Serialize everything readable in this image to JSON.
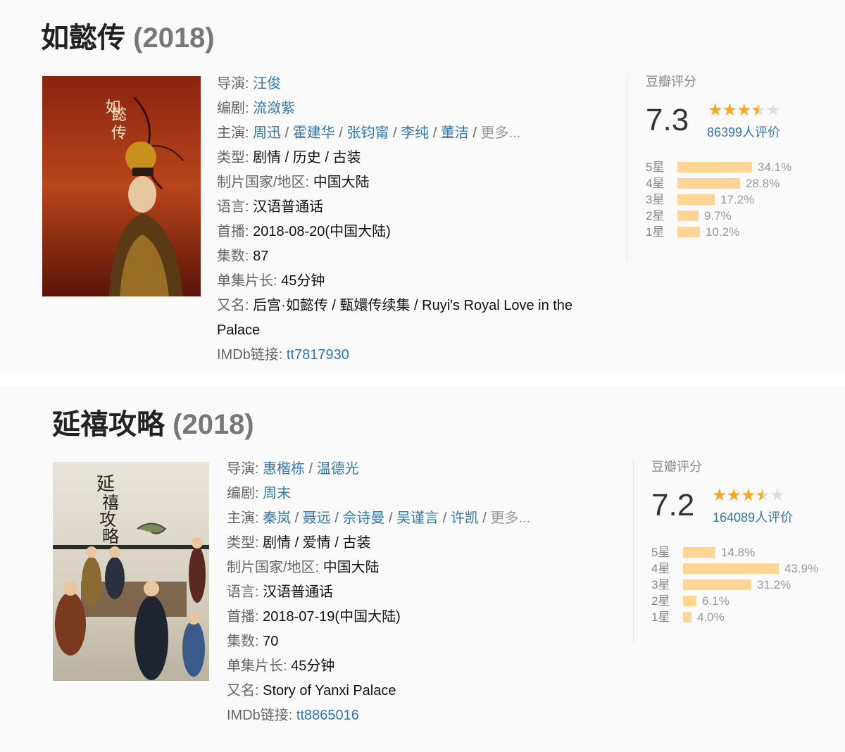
{
  "shows": [
    {
      "title": "如懿传",
      "year": "(2018)",
      "director_label": "导演",
      "directors": [
        "汪俊"
      ],
      "writer_label": "编剧",
      "writers": [
        "流潋紫"
      ],
      "cast_label": "主演",
      "cast": [
        "周迅",
        "霍建华",
        "张钧甯",
        "李纯",
        "董洁"
      ],
      "cast_more": "更多...",
      "genre_label": "类型",
      "genres": [
        "剧情",
        "历史",
        "古装"
      ],
      "region_label": "制片国家/地区",
      "region": "中国大陆",
      "language_label": "语言",
      "language": "汉语普通话",
      "premiere_label": "首播",
      "premiere": "2018-08-20(中国大陆)",
      "episodes_label": "集数",
      "episodes": "87",
      "runtime_label": "单集片长",
      "runtime": "45分钟",
      "aka_label": "又名",
      "aka_line1": "后宫·如懿传 / 甄嬛传续集 / Ruyi's Royal Love in the",
      "aka_line2": "Palace",
      "imdb_label": "IMDb链接",
      "imdb": "tt7817930",
      "rating_label": "豆瓣评分",
      "score": "7.3",
      "star_rating": 3.5,
      "votes": "86399人评价",
      "distribution": [
        {
          "star": "5星",
          "percent": "34.1%",
          "value": 34.1
        },
        {
          "star": "4星",
          "percent": "28.8%",
          "value": 28.8
        },
        {
          "star": "3星",
          "percent": "17.2%",
          "value": 17.2
        },
        {
          "star": "2星",
          "percent": "9.7%",
          "value": 9.7
        },
        {
          "star": "1星",
          "percent": "10.2%",
          "value": 10.2
        }
      ]
    },
    {
      "title": "延禧攻略",
      "year": "(2018)",
      "director_label": "导演",
      "directors": [
        "惠楷栋",
        "温德光"
      ],
      "writer_label": "编剧",
      "writers": [
        "周末"
      ],
      "cast_label": "主演",
      "cast": [
        "秦岚",
        "聂远",
        "佘诗曼",
        "吴谨言",
        "许凯"
      ],
      "cast_more": "更多...",
      "genre_label": "类型",
      "genres": [
        "剧情",
        "爱情",
        "古装"
      ],
      "region_label": "制片国家/地区",
      "region": "中国大陆",
      "language_label": "语言",
      "language": "汉语普通话",
      "premiere_label": "首播",
      "premiere": "2018-07-19(中国大陆)",
      "episodes_label": "集数",
      "episodes": "70",
      "runtime_label": "单集片长",
      "runtime": "45分钟",
      "aka_label": "又名",
      "aka_line1": "Story of Yanxi Palace",
      "imdb_label": "IMDb链接",
      "imdb": "tt8865016",
      "rating_label": "豆瓣评分",
      "score": "7.2",
      "star_rating": 3.5,
      "votes": "164089人评价",
      "distribution": [
        {
          "star": "5星",
          "percent": "14.8%",
          "value": 14.8
        },
        {
          "star": "4星",
          "percent": "43.9%",
          "value": 43.9
        },
        {
          "star": "3星",
          "percent": "31.2%",
          "value": 31.2
        },
        {
          "star": "2星",
          "percent": "6.1%",
          "value": 6.1
        },
        {
          "star": "1星",
          "percent": "4.0%",
          "value": 4.0
        }
      ]
    }
  ]
}
